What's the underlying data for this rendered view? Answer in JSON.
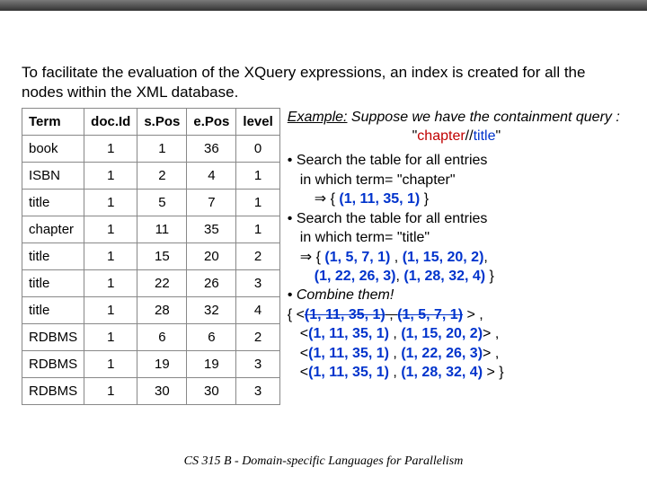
{
  "intro": "To facilitate the evaluation of the XQuery expressions, an index is created for all the nodes within the XML database.",
  "table": {
    "headers": [
      "Term",
      "doc.Id",
      "s.Pos",
      "e.Pos",
      "level"
    ],
    "rows": [
      [
        "book",
        "1",
        "1",
        "36",
        "0"
      ],
      [
        "ISBN",
        "1",
        "2",
        "4",
        "1"
      ],
      [
        "title",
        "1",
        "5",
        "7",
        "1"
      ],
      [
        "chapter",
        "1",
        "11",
        "35",
        "1"
      ],
      [
        "title",
        "1",
        "15",
        "20",
        "2"
      ],
      [
        "title",
        "1",
        "22",
        "26",
        "3"
      ],
      [
        "title",
        "1",
        "28",
        "32",
        "4"
      ],
      [
        "RDBMS",
        "1",
        "6",
        "6",
        "2"
      ],
      [
        "RDBMS",
        "1",
        "19",
        "19",
        "3"
      ],
      [
        "RDBMS",
        "1",
        "30",
        "30",
        "3"
      ]
    ]
  },
  "right": {
    "example_label": "Example:",
    "example_rest": " Suppose we have the containment query :",
    "query_prefix": "\"",
    "query_chapter": "chapter",
    "query_slashes": "//",
    "query_title": "title",
    "query_suffix": "\"",
    "b1a": "• Search the table for all entries",
    "b1b": "in which term= \"chapter\"",
    "imp1a": "⇒ { ",
    "imp1b": "(1, 11, 35, 1)",
    "imp1c": " }",
    "b2a": "• Search the table for all entries",
    "b2b": "in which term= \"title\"",
    "imp2a": "⇒   { ",
    "imp2b": "(1, 5, 7, 1)",
    "imp2c": "  , ",
    "imp2d": "(1, 15, 20, 2)",
    "imp2e": ",",
    "imp2row2a": "(1, 22, 26, 3)",
    "imp2row2b": ", ",
    "imp2row2c": "(1, 28, 32, 4)",
    "imp2row2d": " }",
    "b3": "• Combine them!",
    "res1a": "{ <",
    "res1b": "(1, 11, 35, 1)",
    "res1c": " , ",
    "res1d": "(1, 5, 7, 1)",
    "res1e": " > ,",
    "res2a": "<",
    "res2b": "(1, 11, 35, 1)",
    "res2c": " , ",
    "res2d": "(1, 15, 20, 2)",
    "res2e": "> ,",
    "res3a": "<",
    "res3b": "(1, 11, 35, 1)",
    "res3c": " , ",
    "res3d": "(1, 22, 26, 3)",
    "res3e": "> ,",
    "res4a": "<",
    "res4b": "(1, 11, 35, 1)",
    "res4c": " , ",
    "res4d": "(1, 28, 32, 4)",
    "res4e": " > }"
  },
  "footer": "CS 315 B - Domain-specific Languages for Parallelism"
}
